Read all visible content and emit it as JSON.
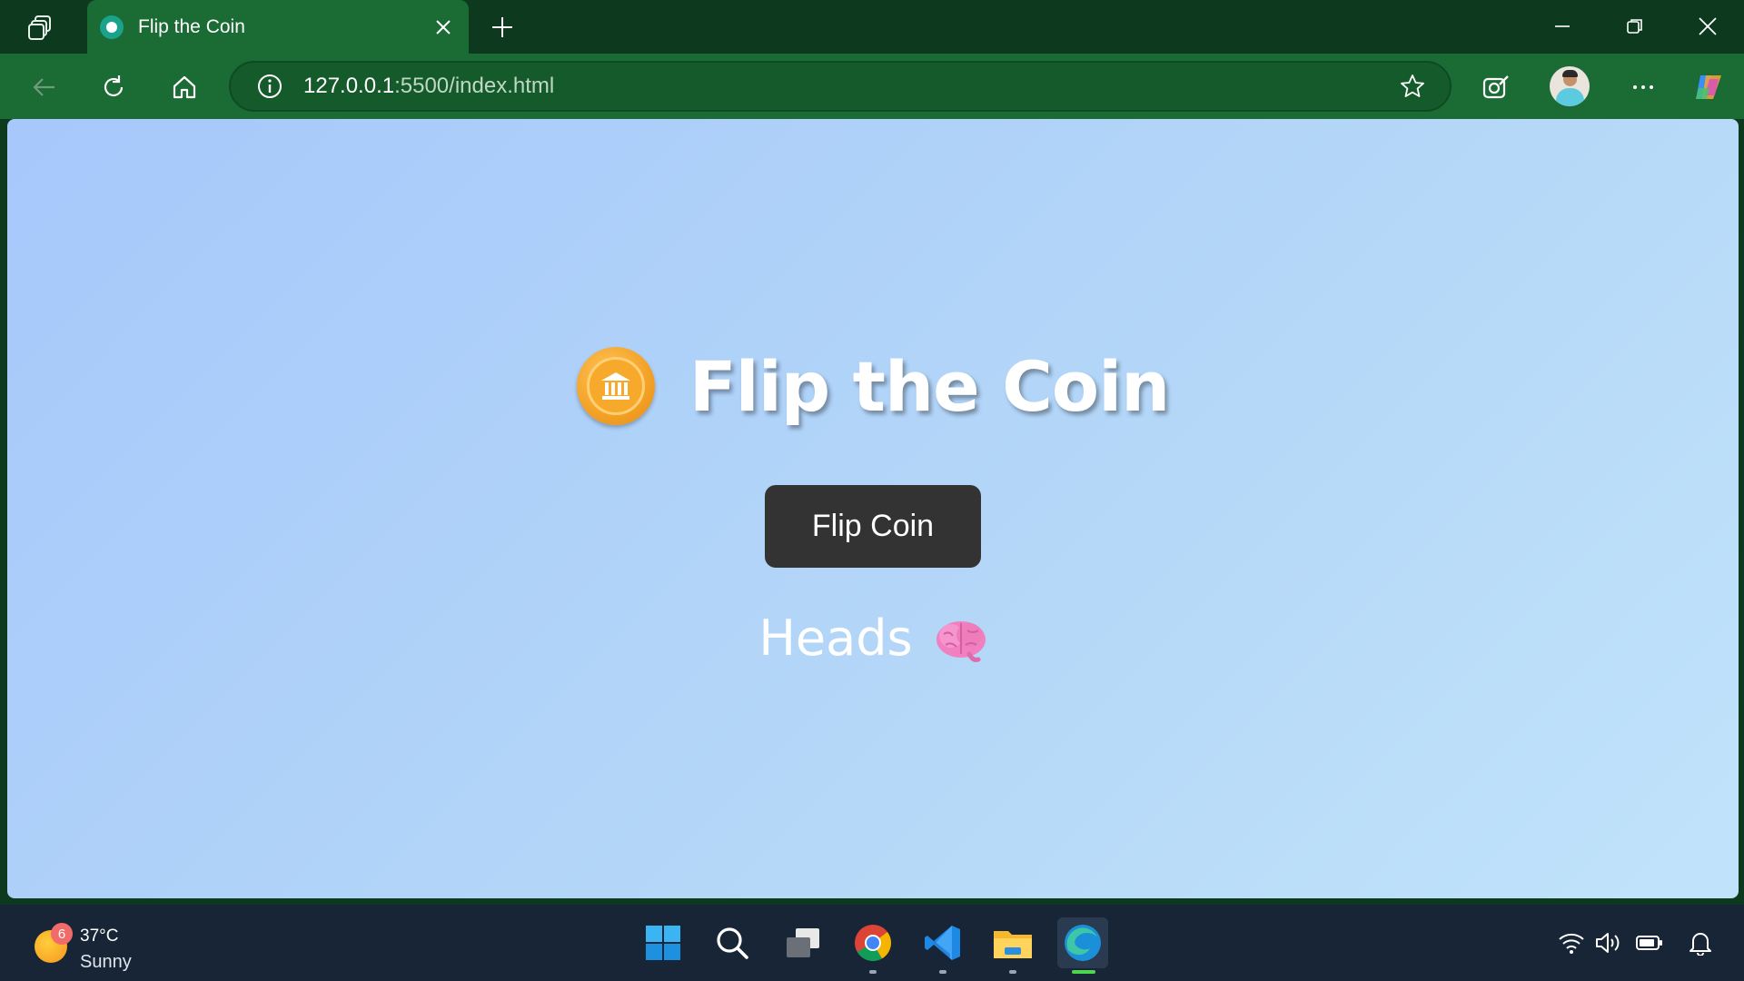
{
  "browser": {
    "tab": {
      "title": "Flip the Coin"
    },
    "address": {
      "url_host": "127.0.0.1",
      "url_path": ":5500/index.html"
    }
  },
  "page": {
    "title": "Flip the Coin",
    "flip_button_label": "Flip Coin",
    "result_text": "Heads",
    "coin_icon": "coin-bank-emoji-icon",
    "result_icon": "brain-emoji-icon"
  },
  "taskbar": {
    "weather": {
      "badge": "6",
      "temperature": "37°C",
      "condition": "Sunny"
    },
    "apps": [
      "start",
      "search",
      "task-view",
      "chrome",
      "vscode",
      "file-explorer",
      "edge"
    ]
  },
  "colors": {
    "titlebar": "#0d3a1f",
    "toolbar": "#1a6b34",
    "page_gradient_start": "#a6c8fb",
    "page_gradient_end": "#c1e3fa",
    "button_bg": "#333333",
    "taskbar": "#172536"
  }
}
